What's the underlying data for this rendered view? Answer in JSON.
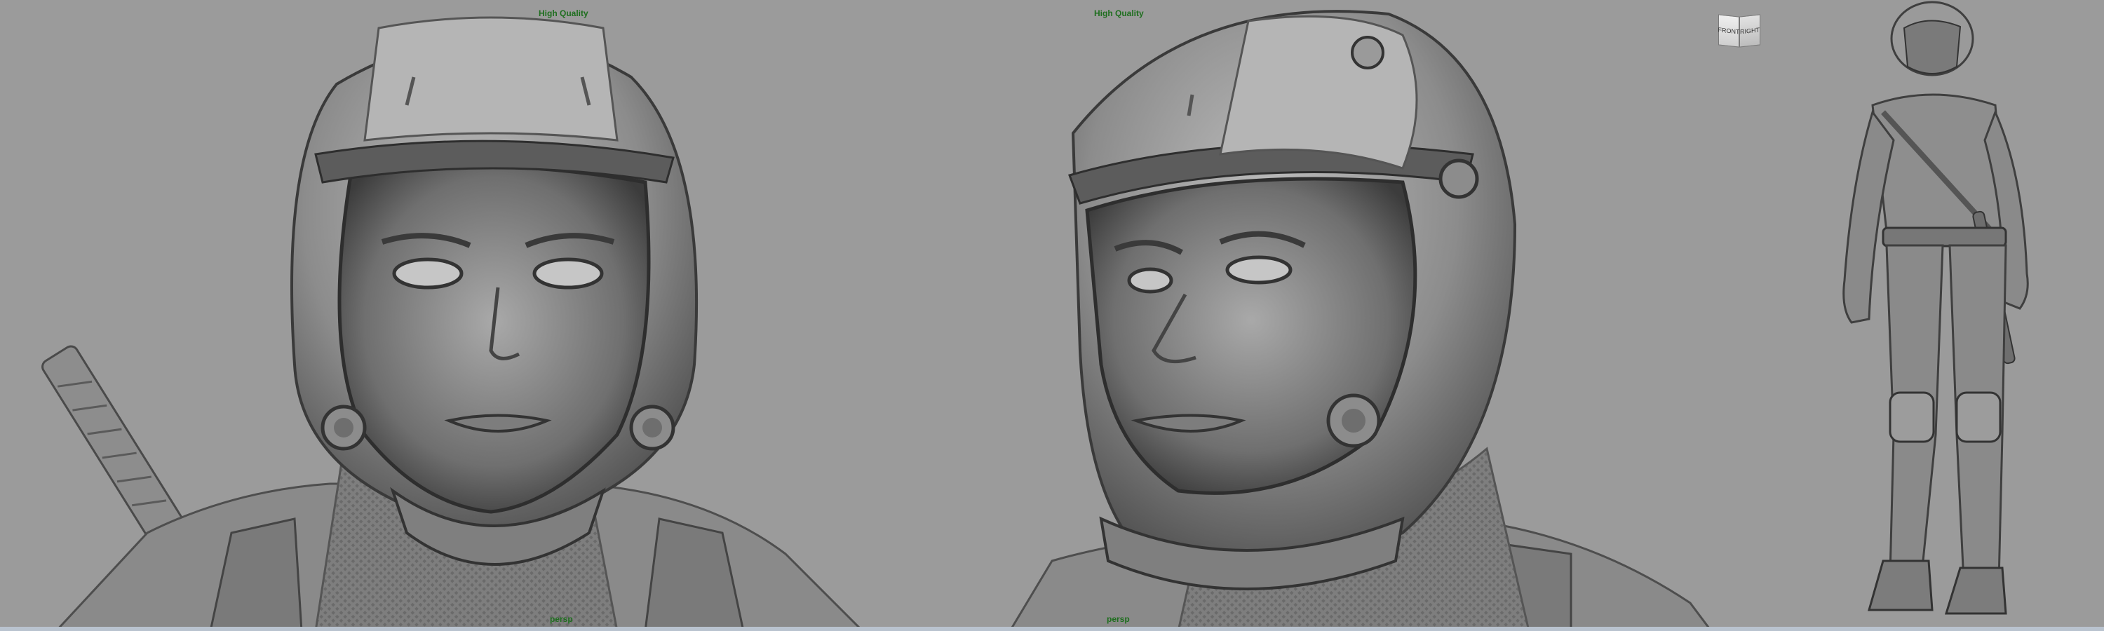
{
  "viewports": {
    "front": {
      "quality_label": "High Quality",
      "camera_label": "persp"
    },
    "perspective": {
      "quality_label": "High Quality",
      "camera_label": "persp"
    },
    "full_body": {}
  },
  "viewcube": {
    "front_label": "FRONT",
    "right_label": "RIGHT"
  },
  "colors": {
    "background": "#9b9b9b",
    "hud_text": "#1e6e1e",
    "model": "#8a8a8a"
  }
}
